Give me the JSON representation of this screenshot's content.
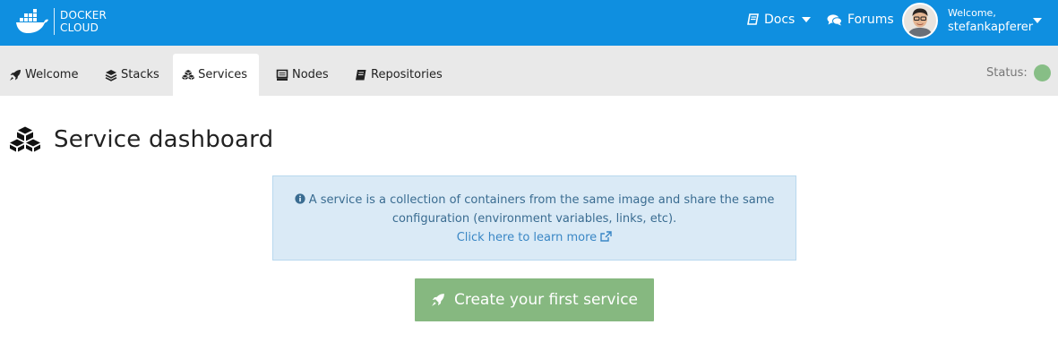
{
  "brand": {
    "line1": "DOCKER",
    "line2": "CLOUD"
  },
  "nav": {
    "docs_label": "Docs",
    "forums_label": "Forums",
    "welcome_label": "Welcome,",
    "username": "stefankapferer"
  },
  "tabs": [
    {
      "label": "Welcome",
      "icon": "rocket-icon"
    },
    {
      "label": "Stacks",
      "icon": "stack-icon"
    },
    {
      "label": "Services",
      "icon": "cubes-icon",
      "active": true
    },
    {
      "label": "Nodes",
      "icon": "server-icon"
    },
    {
      "label": "Repositories",
      "icon": "book-icon"
    }
  ],
  "status": {
    "label": "Status:",
    "color": "#87be86"
  },
  "main": {
    "title": "Service dashboard",
    "info_line1": "A service is a collection of containers from the same image and share the same",
    "info_line2": "configuration (environment variables, links, etc).",
    "info_link": "Click here to learn more",
    "cta_label": "Create your first service"
  },
  "colors": {
    "topbar": "#0f8fe0",
    "tabbar": "#e9e9e9",
    "info_bg": "#daeaf6",
    "cta": "#86b880"
  }
}
